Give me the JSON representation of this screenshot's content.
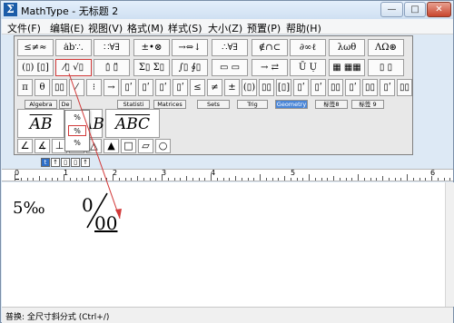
{
  "window": {
    "title": "MathType - 无标题 2",
    "app_icon": "Σ",
    "buttons": {
      "minimize": "—",
      "maximize": "□",
      "close": "✕"
    }
  },
  "menu": {
    "items": [
      "文件(F)",
      "编辑(E)",
      "视图(V)",
      "格式(M)",
      "样式(S)",
      "大小(Z)",
      "预置(P)",
      "帮助(H)"
    ]
  },
  "palette": {
    "row1": [
      "≤≠≈",
      "ȧb∵.",
      "∷∀∃",
      "±•⊗",
      "→⇔↓",
      "∴∀∃",
      "∉∩⊂",
      "∂∞ℓ",
      "λωθ",
      "ΛΩ⊛"
    ],
    "row2": [
      "(▯) [▯]",
      "⁄▯ √▯",
      "▯̇ ▯̈",
      "Σ▯ Σ▯",
      "∫▯ ∮▯",
      "▭ ▭",
      "→ ⇄",
      "Ū Ụ",
      "▦ ▦▦",
      "▯ ▯"
    ],
    "row3": [
      "π",
      "θ",
      "▯▯",
      "⁄",
      "⁝",
      "→",
      "▯ʹ",
      "▯ʹ",
      "▯ʹ",
      "▯ʹ",
      "≤",
      "≠",
      "±",
      "(▯)",
      "▯▯",
      "[▯]",
      "▯ʹ",
      "▯ʹ",
      "▯▯",
      "▯ʹ",
      "▯▯",
      "▯ʹ",
      "▯▯"
    ],
    "tabs": [
      "Algebra",
      "De",
      "Statisti",
      "Matrices",
      "Sets",
      "Trig",
      "Geometry",
      "标签8",
      "标签 9"
    ],
    "active_tab": "Geometry",
    "templates": [
      "AB",
      "AB",
      "ABC"
    ],
    "shapes": [
      "∠",
      "∡",
      "⊥",
      "∥",
      "△",
      "▲",
      "□",
      "▱",
      "○"
    ],
    "fraction_dropdown": [
      "%",
      "%",
      "%"
    ]
  },
  "mini_toolbar": [
    "t",
    "↑",
    "▯",
    "▯",
    "↑"
  ],
  "ruler": {
    "labels": [
      "0",
      "1",
      "2",
      "3",
      "4",
      "5",
      "6"
    ]
  },
  "editor": {
    "text": "5‰",
    "fraction_top": "0",
    "fraction_bottom": "00"
  },
  "status": {
    "text": "普换: 全尺寸斜分式 (Ctrl+/)"
  }
}
